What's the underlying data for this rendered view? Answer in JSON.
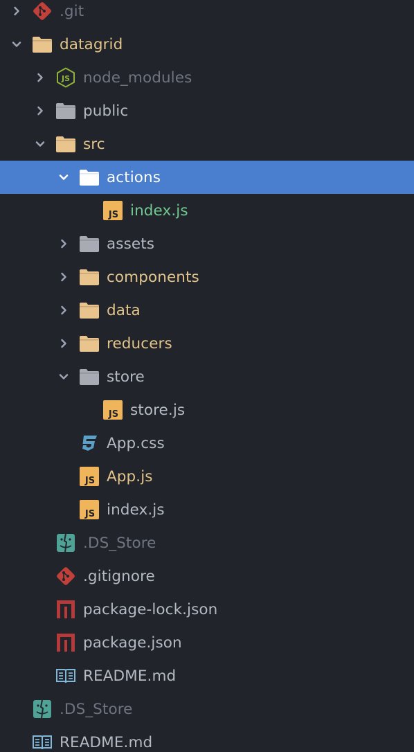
{
  "panel": {
    "name": "file-tree"
  },
  "colors": {
    "background": "#21252b",
    "selection": "#4a7ecf",
    "text_default": "#b4bac4",
    "text_dim": "#6e7480",
    "text_modified": "#e3c48a",
    "text_new": "#73c991",
    "folder_tan": "#e9c48d",
    "folder_gray": "#a8abb3",
    "git_red": "#c1413a",
    "npm_red": "#b73a3a",
    "js_yellow": "#f0b45a",
    "css_blue": "#5aa0c8",
    "ds_teal": "#4fa396",
    "readme_blue": "#7fb8d8",
    "node_green": "#8fb33a"
  },
  "items": [
    {
      "name": "tree-item-git",
      "label": ".git",
      "depth": 0,
      "chevron": "right",
      "icon": "git-icon",
      "color": "dim"
    },
    {
      "name": "tree-item-datagrid",
      "label": "datagrid",
      "depth": 0,
      "chevron": "down",
      "icon": "folder-icon",
      "folder": "tan",
      "color": "modified"
    },
    {
      "name": "tree-item-node-modules",
      "label": "node_modules",
      "depth": 1,
      "chevron": "right",
      "icon": "nodejs-icon",
      "color": "dim"
    },
    {
      "name": "tree-item-public",
      "label": "public",
      "depth": 1,
      "chevron": "right",
      "icon": "folder-icon",
      "folder": "gray",
      "color": "default"
    },
    {
      "name": "tree-item-src",
      "label": "src",
      "depth": 1,
      "chevron": "down",
      "icon": "folder-icon",
      "folder": "tan",
      "color": "modified"
    },
    {
      "name": "tree-item-actions",
      "label": "actions",
      "depth": 2,
      "chevron": "down",
      "icon": "folder-icon",
      "folder": "white",
      "color": "selected",
      "selected": true
    },
    {
      "name": "tree-item-actions-index-js",
      "label": "index.js",
      "depth": 3,
      "chevron": "none",
      "icon": "js-file-icon",
      "color": "new"
    },
    {
      "name": "tree-item-assets",
      "label": "assets",
      "depth": 2,
      "chevron": "right",
      "icon": "folder-icon",
      "folder": "gray",
      "color": "default"
    },
    {
      "name": "tree-item-components",
      "label": "components",
      "depth": 2,
      "chevron": "right",
      "icon": "folder-icon",
      "folder": "tan",
      "color": "modified"
    },
    {
      "name": "tree-item-data",
      "label": "data",
      "depth": 2,
      "chevron": "right",
      "icon": "folder-icon",
      "folder": "tan",
      "color": "modified"
    },
    {
      "name": "tree-item-reducers",
      "label": "reducers",
      "depth": 2,
      "chevron": "right",
      "icon": "folder-icon",
      "folder": "tan",
      "color": "modified"
    },
    {
      "name": "tree-item-store",
      "label": "store",
      "depth": 2,
      "chevron": "down",
      "icon": "folder-icon",
      "folder": "gray",
      "color": "default"
    },
    {
      "name": "tree-item-store-js",
      "label": "store.js",
      "depth": 3,
      "chevron": "none",
      "icon": "js-file-icon",
      "color": "default"
    },
    {
      "name": "tree-item-app-css",
      "label": "App.css",
      "depth": 2,
      "chevron": "none",
      "icon": "css-file-icon",
      "color": "default"
    },
    {
      "name": "tree-item-app-js",
      "label": "App.js",
      "depth": 2,
      "chevron": "none",
      "icon": "js-file-icon",
      "color": "modified"
    },
    {
      "name": "tree-item-src-index-js",
      "label": "index.js",
      "depth": 2,
      "chevron": "none",
      "icon": "js-file-icon",
      "color": "default"
    },
    {
      "name": "tree-item-ds-store-inner",
      "label": ".DS_Store",
      "depth": 1,
      "chevron": "none",
      "icon": "finder-icon",
      "color": "dim"
    },
    {
      "name": "tree-item-gitignore",
      "label": ".gitignore",
      "depth": 1,
      "chevron": "none",
      "icon": "git-icon",
      "color": "default"
    },
    {
      "name": "tree-item-package-lock",
      "label": "package-lock.json",
      "depth": 1,
      "chevron": "none",
      "icon": "npm-icon",
      "color": "default"
    },
    {
      "name": "tree-item-package-json",
      "label": "package.json",
      "depth": 1,
      "chevron": "none",
      "icon": "npm-icon",
      "color": "default"
    },
    {
      "name": "tree-item-readme-inner",
      "label": "README.md",
      "depth": 1,
      "chevron": "none",
      "icon": "book-icon",
      "color": "default"
    },
    {
      "name": "tree-item-ds-store-root",
      "label": ".DS_Store",
      "depth": 0,
      "chevron": "none",
      "icon": "finder-icon",
      "color": "dim"
    },
    {
      "name": "tree-item-readme-root",
      "label": "README.md",
      "depth": 0,
      "chevron": "none",
      "icon": "book-icon",
      "color": "default"
    }
  ]
}
